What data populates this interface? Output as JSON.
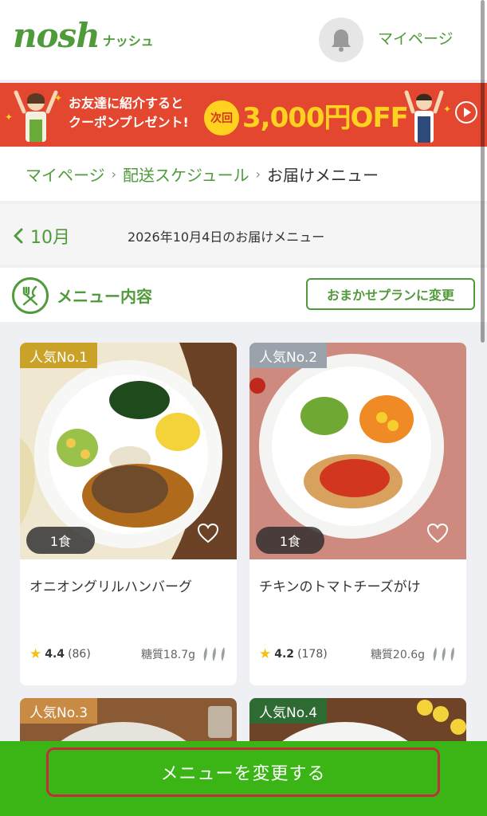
{
  "header": {
    "logo_main": "nosh",
    "logo_sub": "ナッシュ",
    "mypage_label": "マイページ"
  },
  "banner": {
    "line1": "お友達に紹介すると",
    "line2": "クーポンプレゼント!",
    "next_label": "次回",
    "amount": "3,000円OFF",
    "accent_color": "#e4472f"
  },
  "breadcrumb": {
    "items": [
      "マイページ",
      "配送スケジュール",
      "お届けメニュー"
    ]
  },
  "date_bar": {
    "back_label": "10月",
    "title": "2026年10月4日のお届けメニュー"
  },
  "menu_head": {
    "label": "メニュー内容",
    "plan_button": "おまかせプランに変更"
  },
  "cards": [
    {
      "rank": "人気No.1",
      "qty": "1食",
      "name": "オニオングリルハンバーグ",
      "rating": "4.4",
      "reviews": "(86)",
      "carb": "糖質18.7g",
      "rank_color": "#c9a227"
    },
    {
      "rank": "人気No.2",
      "qty": "1食",
      "name": "チキンのトマトチーズがけ",
      "rating": "4.2",
      "reviews": "(178)",
      "carb": "糖質20.6g",
      "rank_color": "#9aa3ab"
    },
    {
      "rank": "人気No.3",
      "rank_color": "#c98a43"
    },
    {
      "rank": "人気No.4",
      "rank_color": "#2e6b33"
    }
  ],
  "footer": {
    "change_button": "メニューを変更する",
    "bar_color": "#3bb516"
  },
  "icons": [
    "bell-icon",
    "play-icon",
    "chevron-left-icon",
    "fork-knife-icon",
    "heart-icon",
    "star-icon",
    "spice-icon"
  ]
}
